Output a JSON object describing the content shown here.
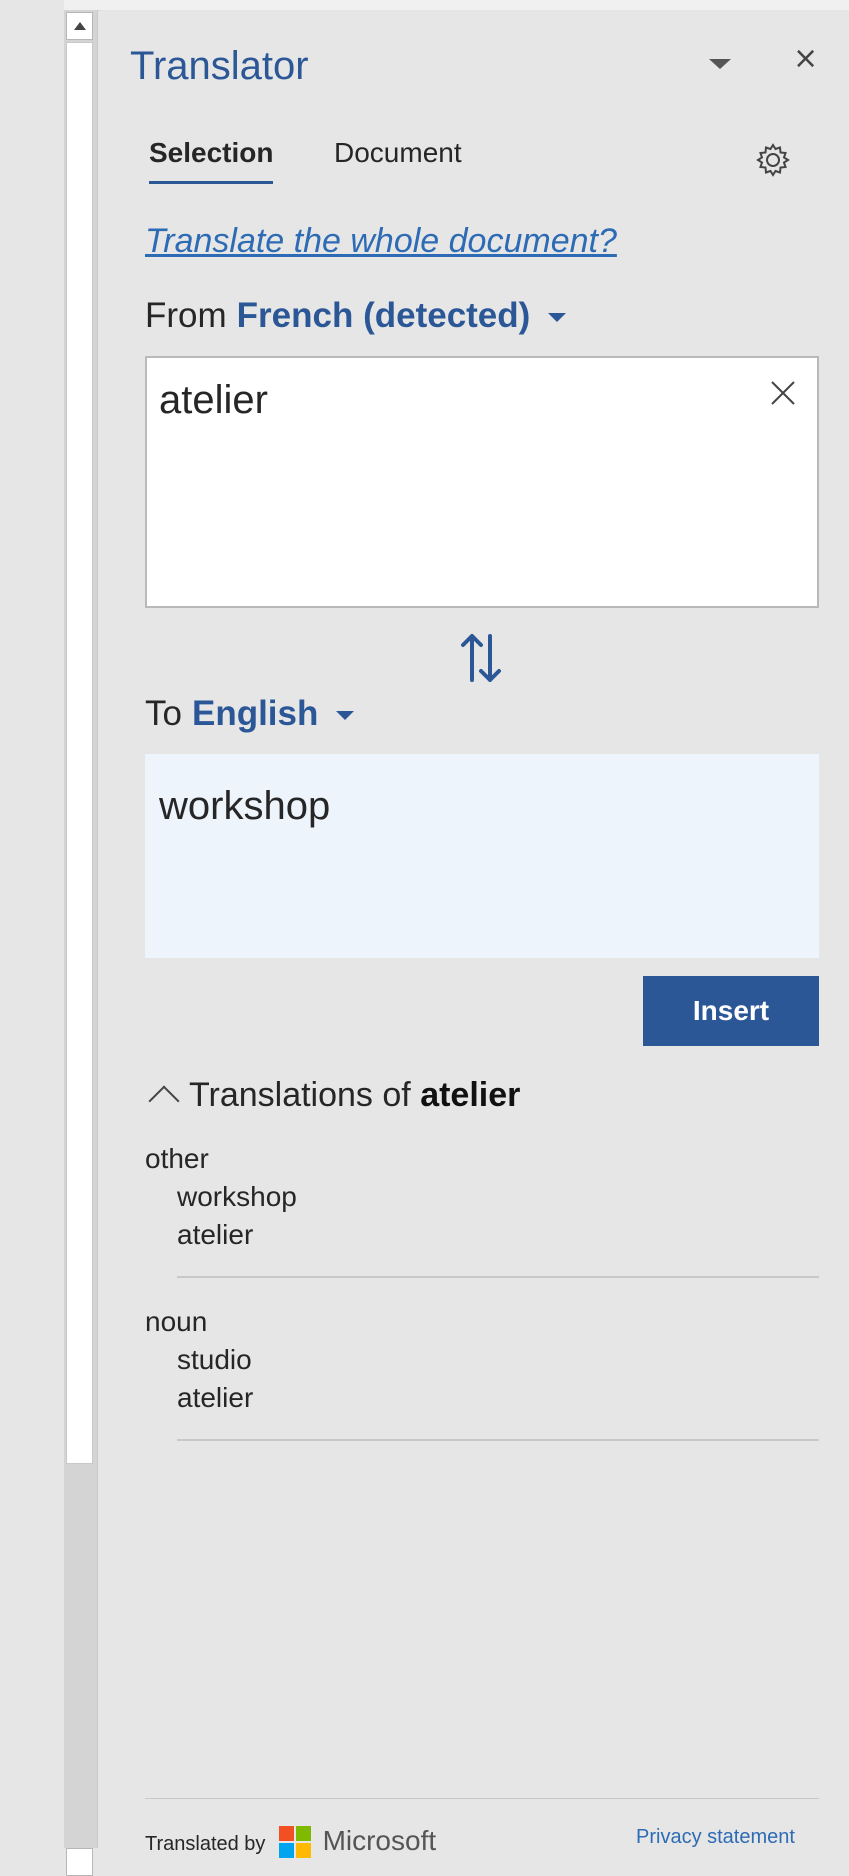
{
  "pane": {
    "title": "Translator",
    "menu_icon": "chevron-down-icon",
    "close_glyph": "×"
  },
  "tabs": [
    {
      "label": "Selection",
      "selected": true
    },
    {
      "label": "Document",
      "selected": false
    }
  ],
  "settings_icon": "gear-icon",
  "whole_document_link": "Translate the whole document?",
  "from": {
    "label": "From",
    "language": "French (detected)"
  },
  "source": {
    "text": "atelier"
  },
  "to": {
    "label": "To",
    "language": "English"
  },
  "target": {
    "text": "workshop"
  },
  "insert_label": "Insert",
  "translations": {
    "prefix": "Translations of",
    "word": "atelier",
    "groups": [
      {
        "pos": "other",
        "items": [
          "workshop",
          "atelier"
        ]
      },
      {
        "pos": "noun",
        "items": [
          "studio",
          "atelier"
        ]
      }
    ]
  },
  "footer": {
    "translated_by": "Translated by",
    "brand": "Microsoft",
    "privacy": "Privacy statement"
  },
  "colors": {
    "accent": "#2b5797",
    "link": "#2d6bb5",
    "target_bg": "#edf4fc"
  }
}
